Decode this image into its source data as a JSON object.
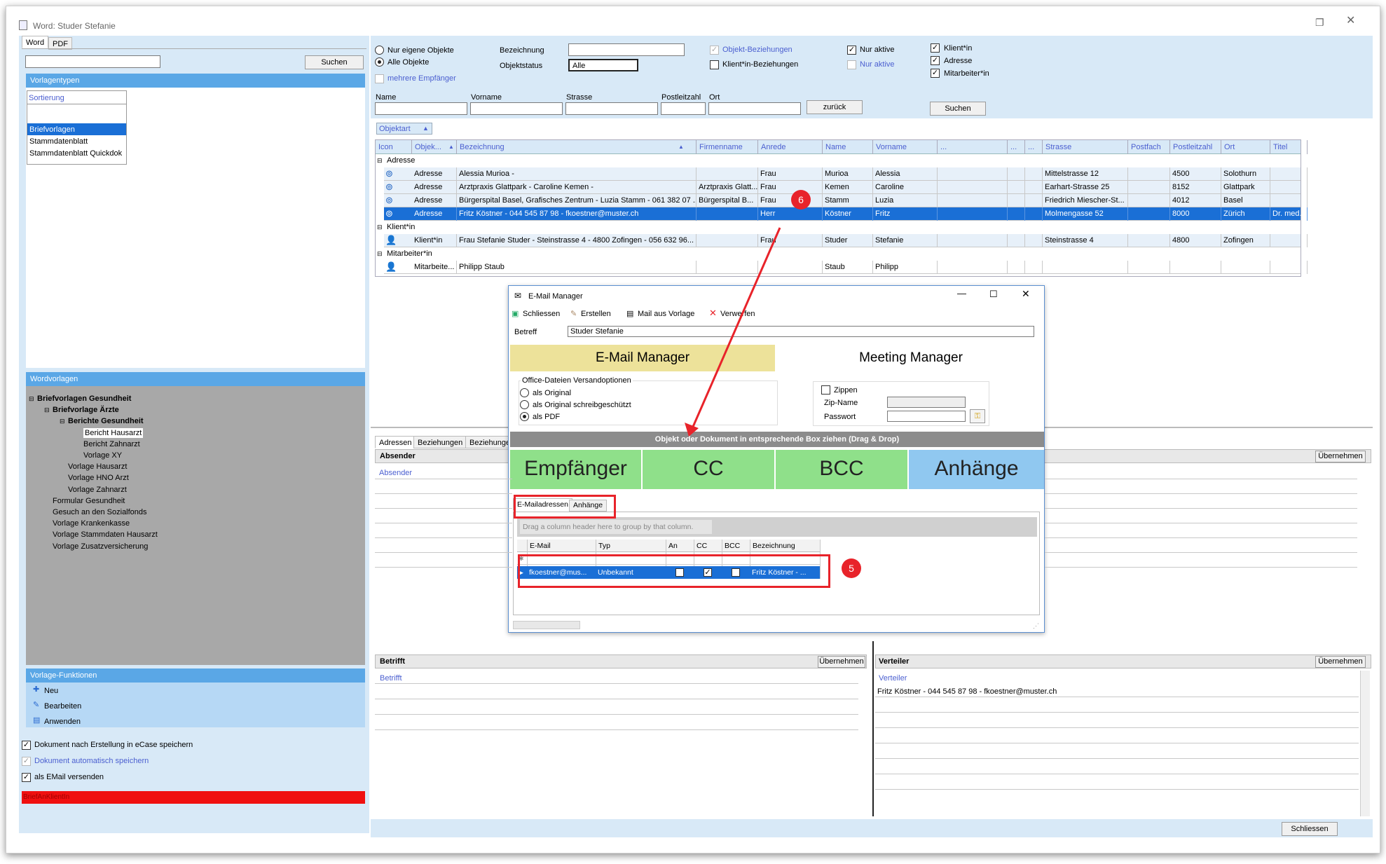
{
  "window": {
    "title": "Word: Studer Stefanie"
  },
  "left": {
    "tabs": [
      "Word",
      "PDF"
    ],
    "search_button": "Suchen",
    "vorlagentypen_header": "Vorlagentypen",
    "sortierung": "Sortierung",
    "types": [
      "Briefvorlagen",
      "Stammdatenblatt",
      "Stammdatenblatt Quickdok"
    ],
    "wordvorlagen_header": "Wordvorlagen",
    "tree": [
      {
        "label": "Briefvorlagen Gesundheit",
        "bold": true,
        "level": 0
      },
      {
        "label": "Briefvorlage Ärzte",
        "bold": true,
        "level": 1
      },
      {
        "label": "Berichte Gesundheit",
        "bold": true,
        "level": 2
      },
      {
        "label": "Bericht Hausarzt",
        "level": 3
      },
      {
        "label": "Bericht Zahnarzt",
        "level": 3
      },
      {
        "label": "Vorlage XY",
        "level": 3
      },
      {
        "label": "Vorlage Hausarzt",
        "level": 2
      },
      {
        "label": "Vorlage HNO Arzt",
        "level": 2
      },
      {
        "label": "Vorlage Zahnarzt",
        "level": 2
      },
      {
        "label": "Formular Gesundheit",
        "level": 1
      },
      {
        "label": "Gesuch an den Sozialfonds",
        "level": 1
      },
      {
        "label": "Vorlage Krankenkasse",
        "level": 1
      },
      {
        "label": "Vorlage Stammdaten Hausarzt",
        "level": 1
      },
      {
        "label": "Vorlage Zusatzversicherung",
        "level": 1
      }
    ],
    "funktionen_header": "Vorlage-Funktionen",
    "funktionen": [
      "Neu",
      "Bearbeiten",
      "Anwenden"
    ],
    "opt1": "Dokument nach Erstellung in eCase speichern",
    "opt2": "Dokument automatisch speichern",
    "opt3": "als EMail versenden",
    "status_red": "BriefAnKlientIn"
  },
  "filters": {
    "radio1": "Nur eigene Objekte",
    "radio2": "Alle Objekte",
    "mehrere": "mehrere Empfänger",
    "bezeichnung": "Bezeichnung",
    "objektstatus": "Objektstatus",
    "objektstatus_value": "Alle",
    "objekt_bez": "Objekt-Beziehungen",
    "klient_bez": "Klient*in-Beziehungen",
    "nur_aktive": "Nur aktive",
    "nur_aktive2": "Nur aktive",
    "klientin": "Klient*in",
    "adresse": "Adresse",
    "mitarbeiterin": "Mitarbeiter*in",
    "name": "Name",
    "vorname": "Vorname",
    "strasse": "Strasse",
    "plz": "Postleitzahl",
    "ort": "Ort",
    "zurueck": "zurück",
    "suchen": "Suchen"
  },
  "grid": {
    "groupby": "Objektart",
    "columns": [
      "Icon",
      "Objek...",
      "Bezeichnung",
      "Firmenname",
      "Anrede",
      "Name",
      "Vorname",
      "...",
      "...",
      "...",
      "Strasse",
      "Postfach",
      "Postleitzahl",
      "Ort",
      "Titel"
    ],
    "groups": [
      {
        "name": "Adresse",
        "rows": [
          {
            "objekt": "Adresse",
            "bez": "Alessia Murioa -",
            "firma": "",
            "anrede": "Frau",
            "name": "Murioa",
            "vorname": "Alessia",
            "strasse": "Mittelstrasse 12",
            "plz": "4500",
            "ort": "Solothurn",
            "titel": ""
          },
          {
            "objekt": "Adresse",
            "bez": "Arztpraxis Glattpark - Caroline Kemen -",
            "firma": "Arztpraxis Glatt...",
            "anrede": "Frau",
            "name": "Kemen",
            "vorname": "Caroline",
            "strasse": "Earhart-Strasse 25",
            "plz": "8152",
            "ort": "Glattpark",
            "titel": ""
          },
          {
            "objekt": "Adresse",
            "bez": "Bürgerspital Basel, Grafisches Zentrum - Luzia Stamm - 061 382 07 ...",
            "firma": "Bürgerspital B...",
            "anrede": "Frau",
            "name": "Stamm",
            "vorname": "Luzia",
            "strasse": "Friedrich Miescher-St...",
            "plz": "4012",
            "ort": "Basel",
            "titel": ""
          },
          {
            "objekt": "Adresse",
            "bez": "Fritz Köstner - 044 545 87 98 - fkoestner@muster.ch",
            "firma": "",
            "anrede": "Herr",
            "name": "Köstner",
            "vorname": "Fritz",
            "strasse": "Molmengasse 52",
            "plz": "8000",
            "ort": "Zürich",
            "titel": "Dr. med.",
            "selected": true
          }
        ]
      },
      {
        "name": "Klient*in",
        "rows": [
          {
            "objekt": "Klient*in",
            "bez": "Frau Stefanie Studer - Steinstrasse 4 - 4800 Zofingen - 056 632 96...",
            "firma": "",
            "anrede": "Frau",
            "name": "Studer",
            "vorname": "Stefanie",
            "strasse": "Steinstrasse 4",
            "plz": "4800",
            "ort": "Zofingen",
            "titel": ""
          }
        ]
      },
      {
        "name": "Mitarbeiter*in",
        "rows": [
          {
            "objekt": "Mitarbeite...",
            "bez": "Philipp Staub",
            "firma": "",
            "anrede": "",
            "name": "Staub",
            "vorname": "Philipp",
            "strasse": "",
            "plz": "",
            "ort": "",
            "titel": ""
          }
        ]
      }
    ]
  },
  "lower": {
    "tabs": [
      "Adressen",
      "Beziehungen",
      "Beziehungen"
    ],
    "absender": "Absender",
    "absender_col": "Absender",
    "uebernehmen": "Übernehmen",
    "betrifft": "Betrifft",
    "betrifft_col": "Betrifft",
    "verteiler": "Verteiler",
    "verteiler_col": "Verteiler",
    "verteiler_entry": "Fritz Köstner - 044 545 87 98 - fkoestner@muster.ch",
    "schliessen": "Schliessen"
  },
  "dialog": {
    "title": "E-Mail Manager",
    "toolbar": [
      "Schliessen",
      "Erstellen",
      "Mail aus Vorlage",
      "Verwerfen"
    ],
    "betreff_label": "Betreff",
    "betreff_value": "Studer Stefanie",
    "email_manager": "E-Mail Manager",
    "meeting_manager": "Meeting Manager",
    "office_options": "Office-Dateien Versandoptionen",
    "opt_original": "als Original",
    "opt_schreib": "als Original schreibgeschützt",
    "opt_pdf": "als PDF",
    "zippen": "Zippen",
    "zip_name": "Zip-Name",
    "passwort": "Passwort",
    "dragbar": "Objekt oder Dokument in entsprechende Box ziehen (Drag & Drop)",
    "boxes": [
      "Empfänger",
      "CC",
      "BCC",
      "Anhänge"
    ],
    "tabs": [
      "E-Mailadressen",
      "Anhänge"
    ],
    "group_hint": "Drag a column header here to group by that column.",
    "columns": [
      "E-Mail",
      "Typ",
      "An",
      "CC",
      "BCC",
      "Bezeichnung"
    ],
    "row": {
      "email": "fkoestner@mus...",
      "typ": "Unbekannt",
      "bez": "Fritz Köstner - ..."
    }
  },
  "badges": {
    "b5": "5",
    "b6": "6"
  },
  "colors": {
    "accent": "#5aa7e6",
    "selected": "#1a6fd6",
    "red": "#e8232a",
    "green": "#8fe08a",
    "lightblue": "#90c8f0",
    "yellow": "#ede29a"
  }
}
